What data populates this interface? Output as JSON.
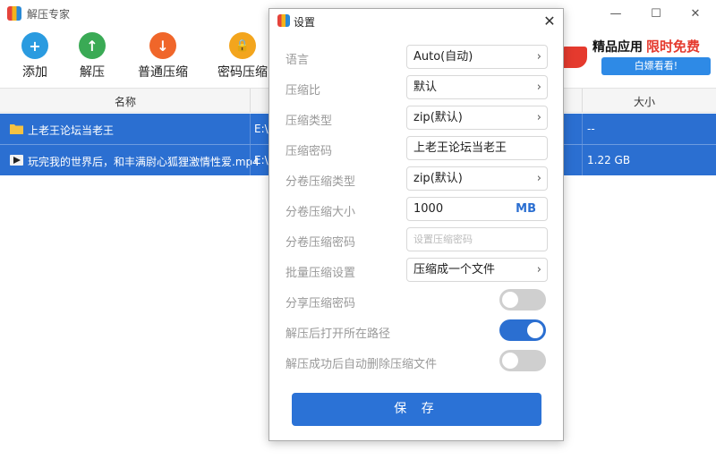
{
  "window": {
    "title": "解压专家"
  },
  "toolbar": [
    {
      "label": "添加",
      "color": "#2a9be0",
      "glyph": "+"
    },
    {
      "label": "解压",
      "color": "#3aaa55",
      "glyph": "↑"
    },
    {
      "label": "普通压缩",
      "color": "#f0662a",
      "glyph": "↓"
    },
    {
      "label": "密码压缩",
      "color": "#f3a51d",
      "glyph": "🔒"
    }
  ],
  "ad": {
    "title_black": "精品应用",
    "title_red": "限时免费",
    "button": "白嫖看看!"
  },
  "list": {
    "headers": {
      "name": "名称",
      "size": "大小"
    },
    "rows": [
      {
        "name": "上老王论坛当老王",
        "path": "E:\\",
        "size": "--",
        "type": "folder"
      },
      {
        "name": "玩完我的世界后，和丰满尉心狐狸激情性爱.mp4",
        "path": "E:\\",
        "size": "1.22 GB",
        "type": "video"
      }
    ]
  },
  "dialog": {
    "title": "设置",
    "fields": {
      "language": {
        "label": "语言",
        "value": "Auto(自动)"
      },
      "ratio": {
        "label": "压缩比",
        "value": "默认"
      },
      "type": {
        "label": "压缩类型",
        "value": "zip(默认)"
      },
      "password": {
        "label": "压缩密码",
        "value": "上老王论坛当老王"
      },
      "split_type": {
        "label": "分卷压缩类型",
        "value": "zip(默认)"
      },
      "split_size": {
        "label": "分卷压缩大小",
        "value": "1000",
        "unit": "MB"
      },
      "split_password": {
        "label": "分卷压缩密码",
        "placeholder": "设置压缩密码"
      },
      "batch": {
        "label": "批量压缩设置",
        "value": "压缩成一个文件"
      },
      "share_password": {
        "label": "分享压缩密码",
        "on": false
      },
      "open_after": {
        "label": "解压后打开所在路径",
        "on": true
      },
      "delete_after": {
        "label": "解压成功后自动删除压缩文件",
        "on": false
      }
    },
    "save": "保 存"
  },
  "colors": {
    "accent": "#2b6fd1",
    "selection": "#2b6fd1",
    "toggle_off": "#cfcfcf"
  }
}
